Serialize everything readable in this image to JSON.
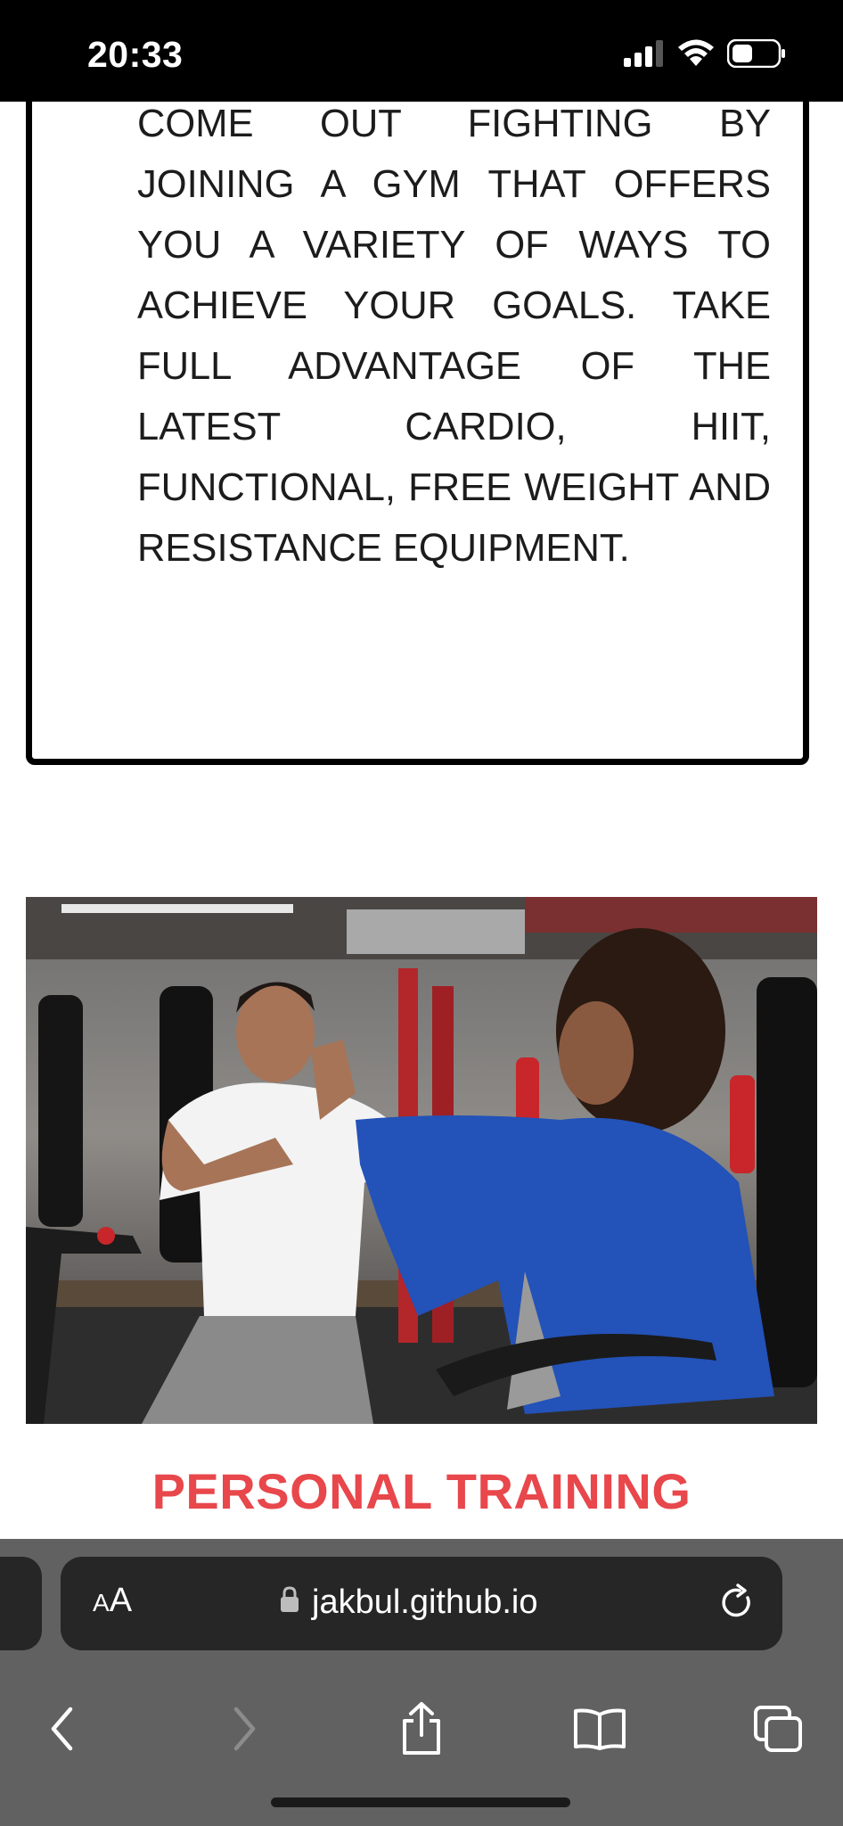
{
  "status_bar": {
    "time": "20:33"
  },
  "main": {
    "intro_paragraph": "Come out fighting by joining a gym that offers you a variety of ways to achieve your goals. Take full advantage of the latest cardio, HIIT, functional, free weight and resistance equipment.",
    "section_title": "PERSONAL TRAINING",
    "title_color": "#e8474b"
  },
  "browser": {
    "text_size_button": {
      "small": "A",
      "large": "A"
    },
    "url": "jakbul.github.io",
    "icons": [
      "lock-icon",
      "reload-icon",
      "back-icon",
      "forward-icon",
      "share-icon",
      "bookmarks-icon",
      "tabs-icon"
    ]
  }
}
